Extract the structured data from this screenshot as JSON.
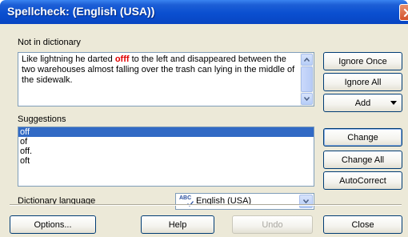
{
  "window": {
    "title": "Spellcheck:  (English (USA))",
    "close_label": "✕"
  },
  "not_in_dictionary": {
    "label": "Not in dictionary",
    "text_before": "Like lightning he darted ",
    "misspelled_word": "offf",
    "text_after": " to the left and disappeared between the two warehouses almost falling over the trash can lying in the middle of the sidewalk."
  },
  "suggestions": {
    "label": "Suggestions",
    "items": [
      "off",
      "of",
      "off.",
      "oft"
    ],
    "selected": "off"
  },
  "dictionary": {
    "label": "Dictionary language",
    "icon_text": "ABC",
    "value": "English (USA)"
  },
  "buttons": {
    "ignore_once": "Ignore Once",
    "ignore_all": "Ignore All",
    "add": "Add",
    "change": "Change",
    "change_all": "Change All",
    "autocorrect": "AutoCorrect",
    "options": "Options...",
    "help": "Help",
    "undo": "Undo",
    "close": "Close"
  },
  "colors": {
    "titlebar": "#0a4fd0",
    "dialog_bg": "#ece9d8",
    "selection": "#316ac5",
    "misspelled": "#e00000"
  }
}
